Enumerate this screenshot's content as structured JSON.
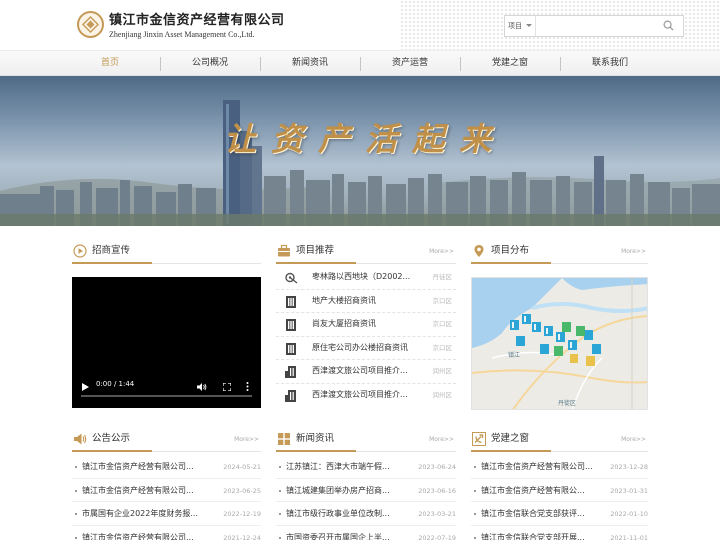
{
  "header": {
    "company_cn": "镇江市金信资产经营有限公司",
    "company_en": "Zhenjiang Jinxin Asset Management Co.,Ltd.",
    "search_scope": "项目",
    "search_icon": "search-icon"
  },
  "nav": {
    "items": [
      "首页",
      "公司概况",
      "新闻资讯",
      "资产运营",
      "党建之窗",
      "联系我们"
    ],
    "active": "首页"
  },
  "banner": {
    "slogan": "让资产活起来"
  },
  "colors": {
    "accent": "#c49a56",
    "text": "#333333",
    "muted": "#aaaaaa"
  },
  "sections": {
    "promo": {
      "title": "招商宣传",
      "icon": "play-circle-icon"
    },
    "projects": {
      "title": "项目推荐",
      "more": "More>>",
      "icon": "briefcase-icon",
      "items": [
        {
          "name": "枣林路以西地块（D2002...",
          "district": "丹徒区",
          "icon": "land-icon"
        },
        {
          "name": "地产大楼招商资讯",
          "district": "京口区",
          "icon": "building-icon"
        },
        {
          "name": "尚友大厦招商资讯",
          "district": "京口区",
          "icon": "building-icon"
        },
        {
          "name": "原住宅公司办公楼招商资讯",
          "district": "京口区",
          "icon": "building-icon"
        },
        {
          "name": "西津渡文旅公司项目推介...",
          "district": "润州区",
          "icon": "building-icon"
        },
        {
          "name": "西津渡文旅公司项目推介...",
          "district": "润州区",
          "icon": "building-icon"
        }
      ]
    },
    "distribution": {
      "title": "项目分布",
      "more": "More>>",
      "icon": "location-pin-icon",
      "map_labels": [
        "丹徒区",
        "镇江"
      ]
    },
    "video": {
      "time": "0:00 / 1:44"
    },
    "notices": {
      "title": "公告公示",
      "more": "More>>",
      "icon": "speaker-icon",
      "items": [
        {
          "title": "镇江市金信资产经营有限公司...",
          "date": "2024-05-21"
        },
        {
          "title": "镇江市金信资产经营有限公司...",
          "date": "2023-06-25"
        },
        {
          "title": "市属国有企业2022年度财务报...",
          "date": "2022-12-19"
        },
        {
          "title": "镇江市金信资产经营有限公司...",
          "date": "2021-12-24"
        }
      ]
    },
    "news": {
      "title": "新闻资讯",
      "more": "More>>",
      "icon": "news-icon",
      "items": [
        {
          "title": "江苏镇江：西津大市端午假...",
          "date": "2023-06-24"
        },
        {
          "title": "镇江城建集团举办房产招商...",
          "date": "2023-06-16"
        },
        {
          "title": "镇江市级行政事业单位改制...",
          "date": "2023-03-21"
        },
        {
          "title": "市国资委召开市属国企上半...",
          "date": "2022-07-19"
        }
      ]
    },
    "party": {
      "title": "党建之窗",
      "more": "More>>",
      "icon": "party-emblem-icon",
      "items": [
        {
          "title": "镇江市金信资产经营有限公司...",
          "date": "2023-12-28"
        },
        {
          "title": "镇江市金信资产经营有限公...",
          "date": "2023-01-31"
        },
        {
          "title": "镇江市金信联合党支部获评...",
          "date": "2022-01-10"
        },
        {
          "title": "镇江市金信联合党支部开展...",
          "date": "2021-11-01"
        }
      ]
    }
  }
}
